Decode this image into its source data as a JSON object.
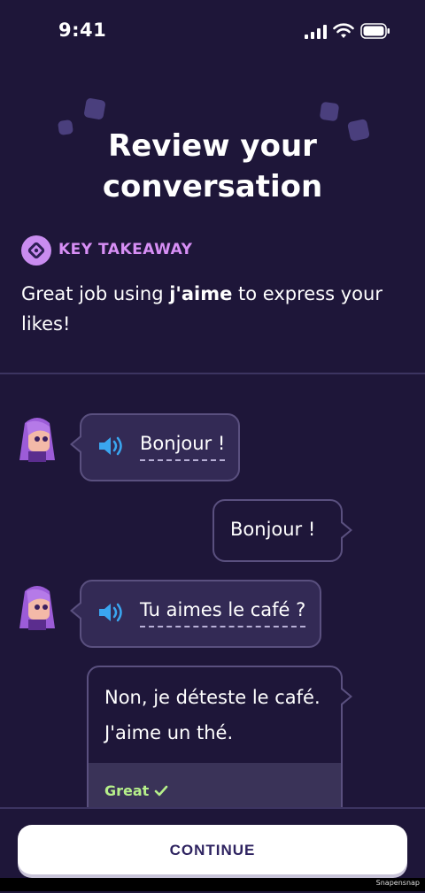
{
  "status_bar": {
    "time": "9:41"
  },
  "header": {
    "title_line1": "Review your",
    "title_line2": "conversation"
  },
  "key_takeaway": {
    "label": "KEY TAKEAWAY",
    "text_before": "Great job using ",
    "text_bold": "j'aime",
    "text_after": " to express your likes!"
  },
  "conversation": {
    "messages": [
      {
        "speaker": "character",
        "text": "Bonjour !"
      },
      {
        "speaker": "user",
        "text": "Bonjour !"
      },
      {
        "speaker": "character",
        "text": "Tu aimes le café ?"
      },
      {
        "speaker": "user",
        "line1": "Non, je déteste le café.",
        "line2": "J'aime un thé.",
        "feedback": "Great"
      }
    ]
  },
  "footer": {
    "continue_label": "CONTINUE",
    "watermark": "Snapensnap"
  },
  "colors": {
    "background": "#1e1639",
    "accent": "#d78ff5",
    "success": "#b6f08a",
    "speaker": "#3aa6f0"
  }
}
